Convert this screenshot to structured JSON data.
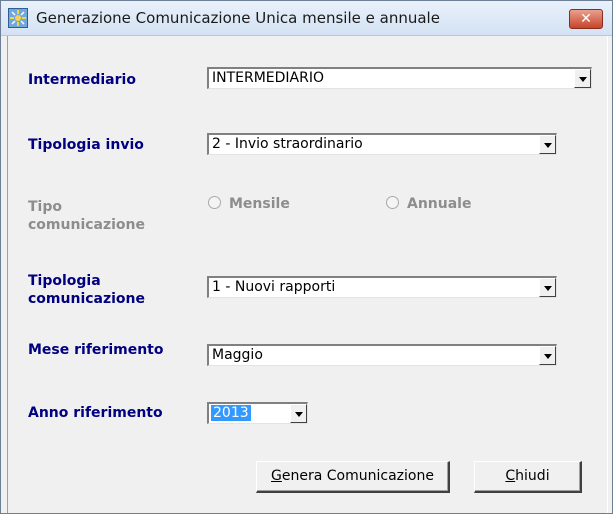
{
  "window": {
    "title": "Generazione Comunicazione Unica mensile e annuale",
    "close_glyph": "✕"
  },
  "form": {
    "intermediario": {
      "label": "Intermediario",
      "value": "INTERMEDIARIO"
    },
    "tipologia_invio": {
      "label": "Tipologia invio",
      "value": "2 - Invio straordinario"
    },
    "tipo_comunicazione": {
      "label_line1": "Tipo",
      "label_line2": "comunicazione",
      "options": [
        "Mensile",
        "Annuale"
      ],
      "enabled": false
    },
    "tipologia_comunicazione": {
      "label_line1": "Tipologia",
      "label_line2": "comunicazione",
      "value": "1 - Nuovi rapporti"
    },
    "mese_riferimento": {
      "label": "Mese riferimento",
      "value": "Maggio"
    },
    "anno_riferimento": {
      "label": "Anno riferimento",
      "value": "2013"
    }
  },
  "buttons": {
    "genera": {
      "accel": "G",
      "rest": "enera Comunicazione"
    },
    "chiudi": {
      "accel": "C",
      "rest": "hiudi"
    }
  },
  "colors": {
    "label": "#000080",
    "disabled": "#8d8d8d",
    "selection": "#3399ff"
  }
}
